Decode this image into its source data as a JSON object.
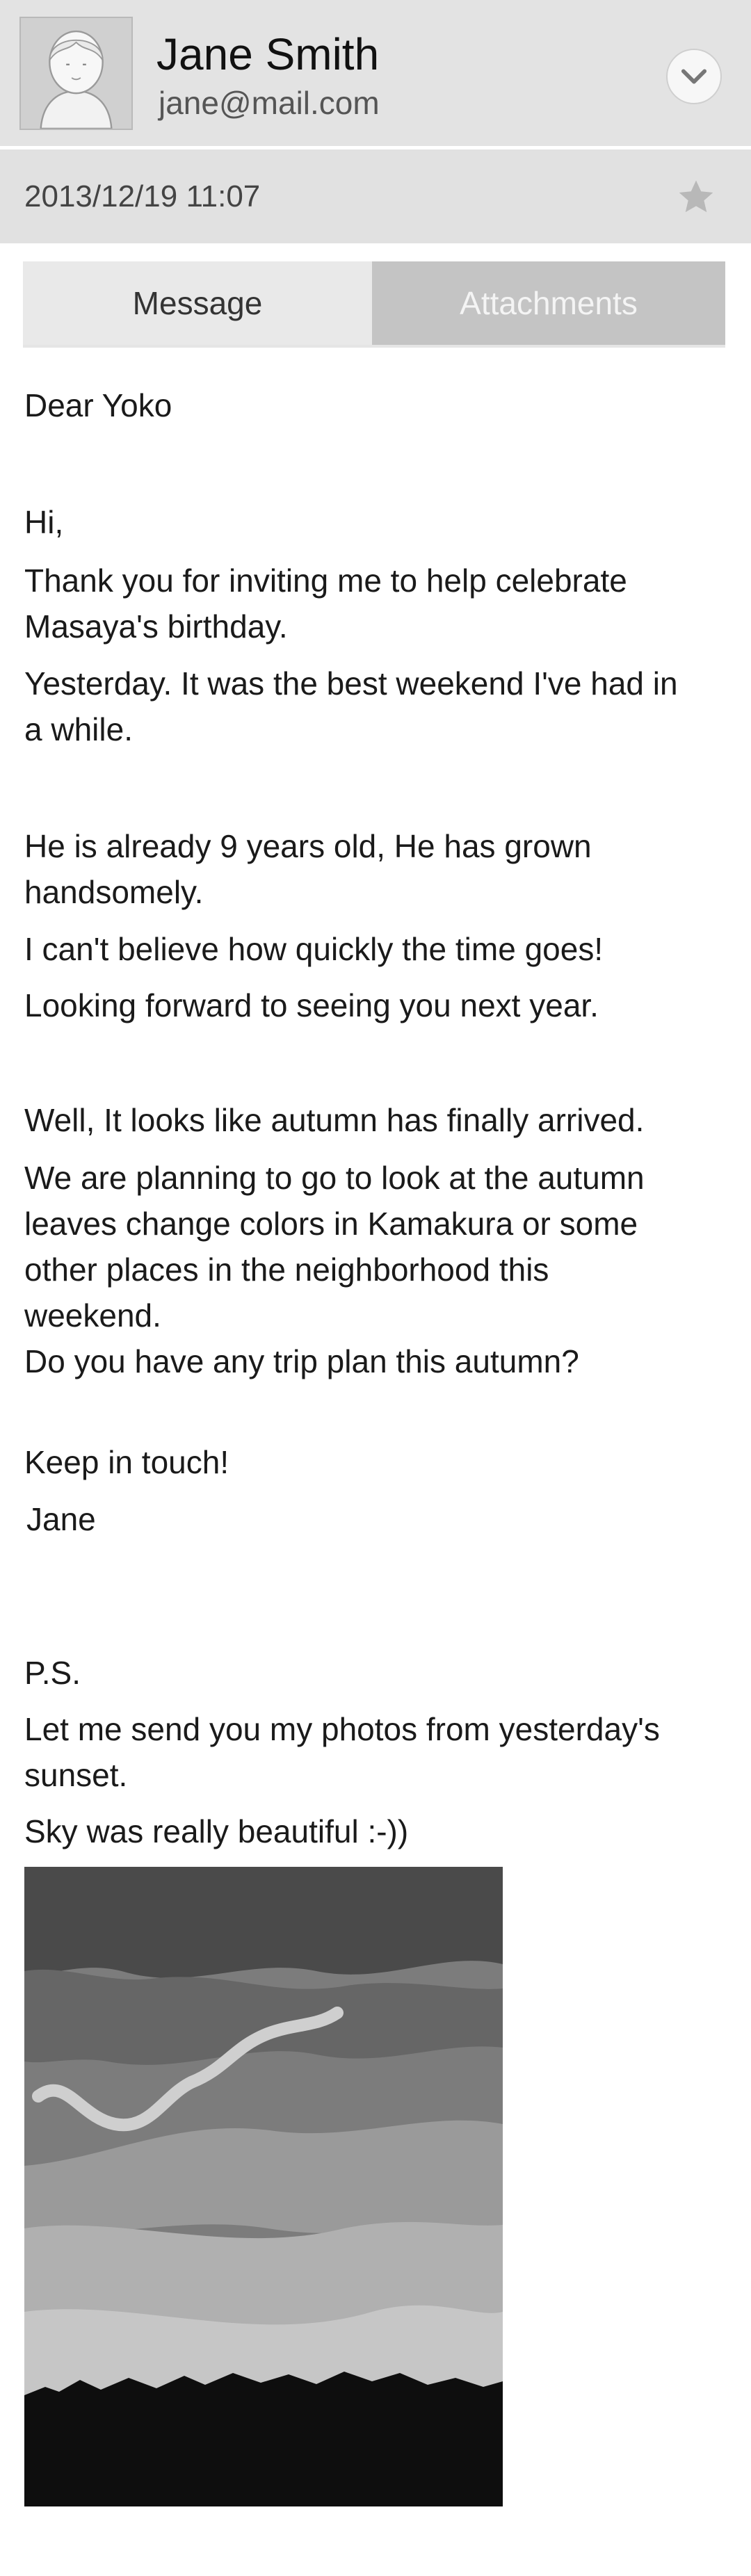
{
  "sender": {
    "name": "Jane Smith",
    "email": "jane@mail.com"
  },
  "meta": {
    "datetime": "2013/12/19  11:07"
  },
  "tabs": {
    "message": "Message",
    "attachments": "Attachments",
    "active": "Message"
  },
  "body": {
    "greeting": "Dear Yoko",
    "hi": "Hi,",
    "p1": [
      "Thank you for inviting me to help celebrate",
      "Masaya's birthday."
    ],
    "p2": [
      "Yesterday. It was the best weekend I've had in",
      "a while."
    ],
    "p3": [
      "He is already 9 years old,    He has grown",
      "handsomely."
    ],
    "p4": "I can't believe how quickly the time goes!",
    "p5": "Looking forward to seeing you next year.",
    "p6": "Well, It looks like autumn has finally arrived.",
    "p7": [
      "We are planning to go to look at the autumn",
      "leaves change colors in Kamakura or some",
      "other places in the neighborhood this",
      "weekend."
    ],
    "p8": "Do you have any trip plan this autumn?",
    "closing": "Keep in touch!",
    "signature": "Jane",
    "ps_label": "P.S.",
    "ps1": [
      "Let me send you my photos from yesterday's",
      "sunset."
    ],
    "ps2": "Sky was really beautiful :-))"
  },
  "icons": {
    "avatar": "avatar",
    "expand": "chevron-down-icon",
    "star": "star-icon"
  },
  "colors": {
    "header_bg": "#e3e3e3",
    "tab_active_bg": "#e9e9e9",
    "tab_inactive_bg": "#c4c4c4"
  }
}
